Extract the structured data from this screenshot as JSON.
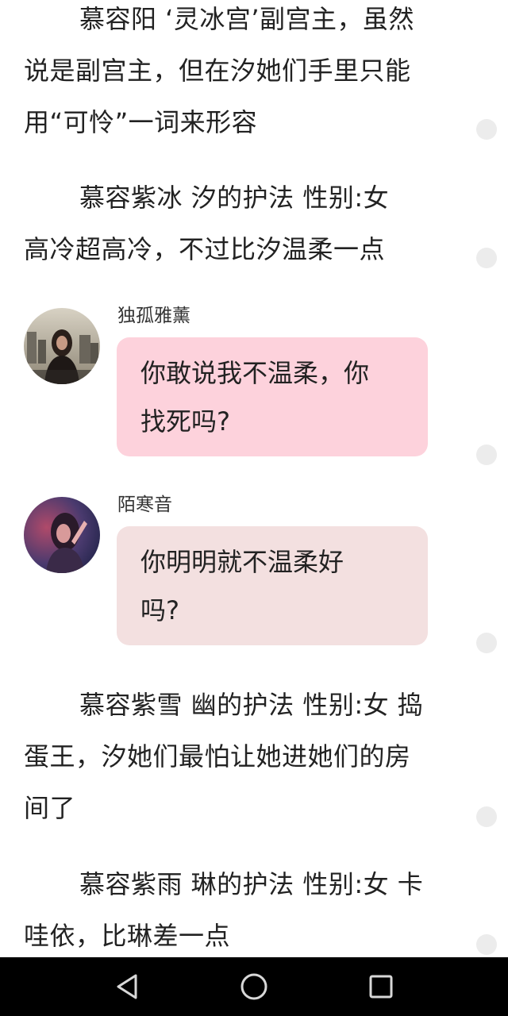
{
  "paragraphs": [
    {
      "line1": "慕容阳 ‘灵冰宫’副宫主，虽然",
      "line2": "说是副宫主，但在汐她们手里只能",
      "line3": "用“可怜”一词来形容"
    },
    {
      "line1": "慕容紫冰  汐的护法  性别:女",
      "line2": "高冷超高冷，不过比汐温柔一点"
    },
    {
      "line1": "慕容紫雪  幽的护法  性别:女  捣",
      "line2": "蛋王，汐她们最怕让她进她们的房",
      "line3": "间了"
    },
    {
      "line1": "慕容紫雨  琳的护法  性别:女  卡",
      "line2": "哇依，比琳差一点"
    }
  ],
  "messages": [
    {
      "speaker": "独孤雅薰",
      "line1": "你敢说我不温柔，你",
      "line2": "找死吗?"
    },
    {
      "speaker": "陌寒音",
      "line1": "你明明就不温柔好",
      "line2": "吗?"
    }
  ],
  "colors": {
    "bubble_pink": "#fdd2dc",
    "bubble_beige": "#f3e0e0",
    "navbar": "#000000"
  },
  "navigation": {
    "back": "back-triangle-icon",
    "home": "home-circle-icon",
    "recents": "recents-square-icon"
  }
}
